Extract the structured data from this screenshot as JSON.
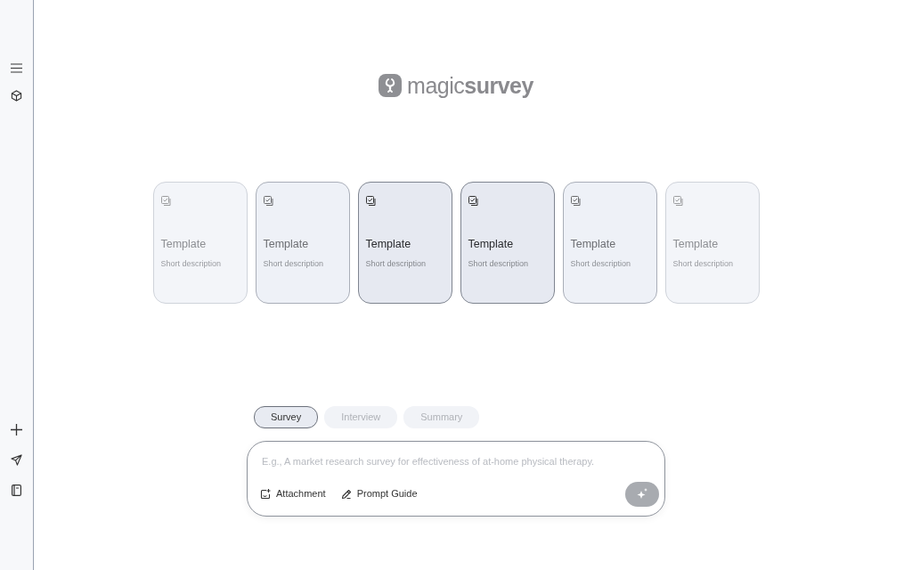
{
  "logo": {
    "text": "magic**survey**"
  },
  "templates": [
    {
      "title": "Template",
      "description": "Short description",
      "kind": "faded"
    },
    {
      "title": "Template",
      "description": "Short description",
      "kind": "dim"
    },
    {
      "title": "Template",
      "description": "Short description",
      "kind": "focus"
    },
    {
      "title": "Template",
      "description": "Short description",
      "kind": "focus"
    },
    {
      "title": "Template",
      "description": "Short description",
      "kind": "dim"
    },
    {
      "title": "Template",
      "description": "Short description",
      "kind": "faded"
    }
  ],
  "modes": [
    {
      "label": "Survey",
      "selected": true
    },
    {
      "label": "Interview",
      "selected": false
    },
    {
      "label": "Summary",
      "selected": false
    }
  ],
  "prompt": {
    "placeholder": "E.g., A market research survey for effectiveness of at-home physical therapy."
  },
  "actions": [
    {
      "label": "Attachment",
      "kind": "attach"
    },
    {
      "label": "Prompt Guide",
      "kind": "guide"
    }
  ]
}
